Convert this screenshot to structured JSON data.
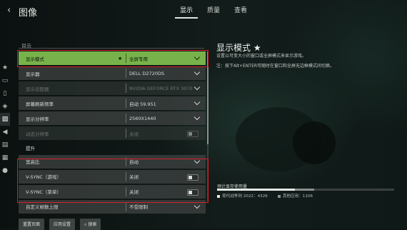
{
  "header": {
    "back_glyph": "‹",
    "title": "图像",
    "tabs": [
      {
        "label": "显示",
        "active": true
      },
      {
        "label": "质量",
        "active": false
      },
      {
        "label": "查看",
        "active": false
      }
    ]
  },
  "rail_icons": [
    "star-icon",
    "display-icon",
    "gamepad-icon",
    "mouse-icon",
    "controller-icon",
    "image-icon",
    "speaker-icon",
    "subtitles-icon",
    "chat-icon",
    "account-icon"
  ],
  "section": {
    "label": "显示"
  },
  "rows": [
    {
      "label": "显示模式",
      "star": "★",
      "value": "全屏专用",
      "control": "dropdown",
      "state": "active"
    },
    {
      "label": "显示器",
      "value": "DELL D2720DS",
      "control": "dropdown",
      "state": "normal"
    },
    {
      "label": "显示适配器",
      "value": "NVIDIA GEFORCE RTX 3070",
      "control": "dropdown",
      "state": "dim"
    },
    {
      "label": "屏幕刷新频率",
      "value": "自动 59.951",
      "control": "dropdown",
      "state": "normal"
    },
    {
      "label": "显示分辨率",
      "value": "2560X1440",
      "control": "dropdown",
      "state": "normal"
    },
    {
      "label": "动态分辨率",
      "value": "关闭",
      "control": "toggle",
      "state": "dim"
    },
    {
      "label": "提升",
      "value": "",
      "control": "none",
      "state": "sub"
    },
    {
      "label": "宽高比",
      "value": "自动",
      "control": "dropdown",
      "state": "normal"
    },
    {
      "label": "V-SYNC（游戏）",
      "value": "关闭",
      "control": "toggle",
      "state": "normal"
    },
    {
      "label": "V-SYNC（菜单）",
      "value": "关闭",
      "control": "toggle",
      "state": "normal"
    },
    {
      "label": "自定义帧数上限",
      "value": "不受限制",
      "control": "dropdown",
      "state": "normal"
    }
  ],
  "detail": {
    "title": "显示模式 ★",
    "description": "设置以可变大小的窗口或全屏模式来显示游戏。",
    "note": "注：按下Alt+ENTER可随时在窗口和全屏无边框模式间切换。"
  },
  "vram": {
    "label": "预计显存使用量",
    "game_usage": "现代战争则 2022：4326",
    "other_usage": "其他应用：1106",
    "game_fraction": 0.44,
    "other_fraction": 0.11,
    "colors": {
      "game": "#e4e8e4",
      "other": "#8a908c"
    }
  },
  "buttons": [
    {
      "label": "重置页面"
    },
    {
      "label": "应用设置"
    },
    {
      "label": "搜索"
    }
  ],
  "colors": {
    "accent": "#77b34a",
    "highlight_box": "#d8202a"
  }
}
